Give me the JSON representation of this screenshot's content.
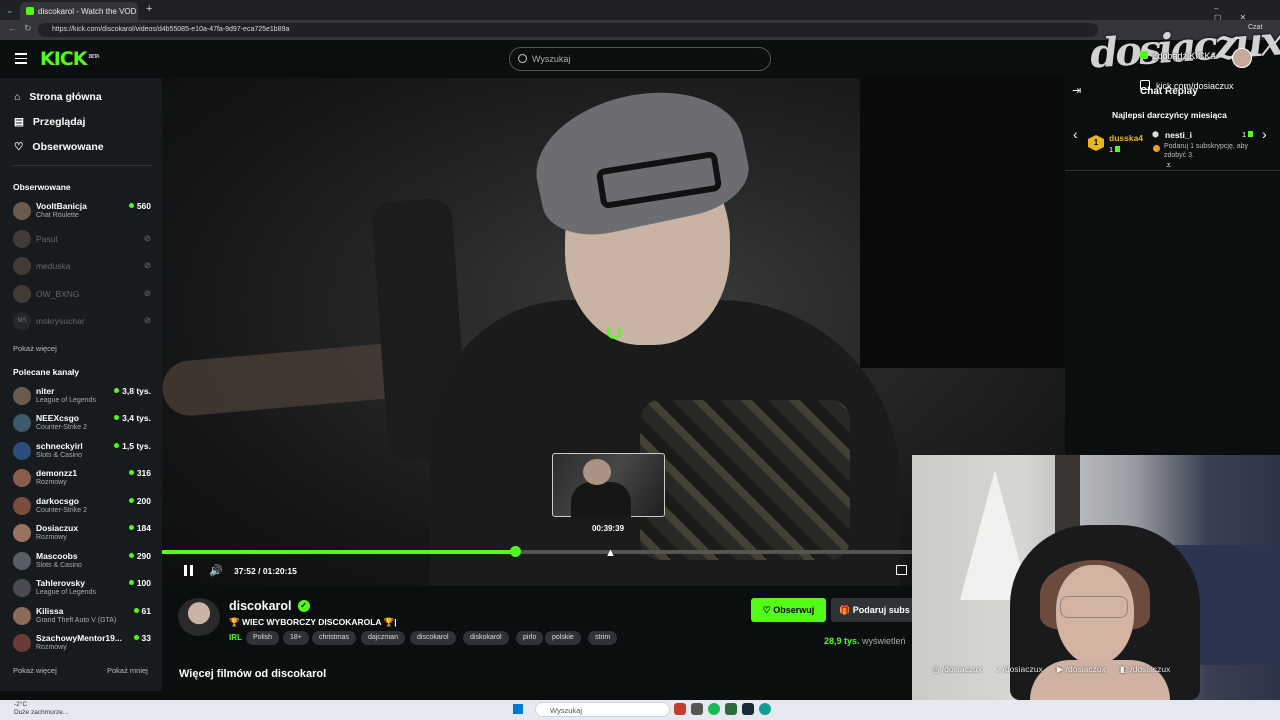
{
  "browser": {
    "tab_title": "discokarol - Watch the VOD o",
    "url": "https://kick.com/discokarol/videos/d4b55085-e10a-47fa-9d97-eca725e1b89a",
    "profile_label": "Czat"
  },
  "header": {
    "logo": "KICK",
    "logo_badge": "BETA",
    "search_placeholder": "Wyszukaj"
  },
  "sidebar": {
    "nav": [
      {
        "label": "Strona główna",
        "icon": "home-icon"
      },
      {
        "label": "Przeglądaj",
        "icon": "browse-icon"
      },
      {
        "label": "Obserwowane",
        "icon": "heart-icon"
      }
    ],
    "followed_title": "Obserwowane",
    "followed": [
      {
        "name": "VooltBanicja",
        "category": "Chat Roulette",
        "viewers": "560",
        "live": true
      },
      {
        "name": "Pasut",
        "live": false
      },
      {
        "name": "meduska",
        "live": false
      },
      {
        "name": "OW_BXNG",
        "live": false
      },
      {
        "name": "mokrysuchar",
        "live": false,
        "initials": "MS"
      }
    ],
    "show_more": "Pokaż więcej",
    "recommended_title": "Polecane kanały",
    "recommended": [
      {
        "name": "niter",
        "category": "League of Legends",
        "viewers": "3,8 tys."
      },
      {
        "name": "NEEXcsgo",
        "category": "Counter-Strike 2",
        "viewers": "3,4 tys."
      },
      {
        "name": "schneckyirl",
        "category": "Slots & Casino",
        "viewers": "1,5 tys."
      },
      {
        "name": "demonzz1",
        "category": "Rozmowy",
        "viewers": "316"
      },
      {
        "name": "darkocsgo",
        "category": "Counter-Strike 2",
        "viewers": "200"
      },
      {
        "name": "Dosiaczux",
        "category": "Rozmowy",
        "viewers": "184"
      },
      {
        "name": "Mascoobs",
        "category": "Slots & Casino",
        "viewers": "290"
      },
      {
        "name": "Tahlerovsky",
        "category": "League of Legends",
        "viewers": "100"
      },
      {
        "name": "Kilissa",
        "category": "Grand Theft Auto V (GTA)",
        "viewers": "61"
      },
      {
        "name": "SzachowyMentor19...",
        "category": "Rozmowy",
        "viewers": "33"
      }
    ],
    "show_more_bottom": "Pokaż więcej",
    "show_less": "Pokaż mniej"
  },
  "player": {
    "hover_time": "00:39:39",
    "current_time": "37:52",
    "duration": "01:20:15",
    "time_display": "37:52 / 01:20:15",
    "progress_fraction": 0.4718
  },
  "stream_info": {
    "streamer": "discokarol",
    "title": "🏆 WIEC WYBORCZY DISCOKAROLA 🏆|",
    "category": "IRL",
    "tags": [
      "Polish",
      "18+",
      "christmas",
      "dajczman",
      "discokarol",
      "diskokarol",
      "pirlo",
      "polskie",
      "strim"
    ],
    "follow_label": "Obserwuj",
    "gift_label": "Podaruj subs",
    "viewers_count": "28,9 tys.",
    "viewers_label": "wyświetleń",
    "more_videos": "Więcej filmów od discokarol"
  },
  "chat": {
    "title": "Chat Replay",
    "top_donors_title": "Najlepsi darczyńcy miesiąca",
    "donors": [
      {
        "rank": "1",
        "name": "dusska4",
        "count": "1"
      },
      {
        "name": "nesti_i",
        "count": "1"
      }
    ],
    "gift_cta": "Podaruj 1 subskrypcję, aby zdobyć 3."
  },
  "overlay": {
    "brand": "dosiaczux",
    "invite": "Zdobądź KICKa",
    "kick_url": "kick.com/dosiaczux",
    "socials": [
      "/dosiaczux",
      "/dosiaczux",
      "/dosiaczux",
      "/dosiaczux"
    ]
  },
  "taskbar": {
    "weather_temp": "-2°C",
    "weather_desc": "Duże zachmurze...",
    "search_placeholder": "Wyszukaj"
  },
  "colors": {
    "kick_green": "#53fc18",
    "background": "#0b0e0f",
    "sidebar": "#181b1d",
    "gold": "#e9b620"
  }
}
